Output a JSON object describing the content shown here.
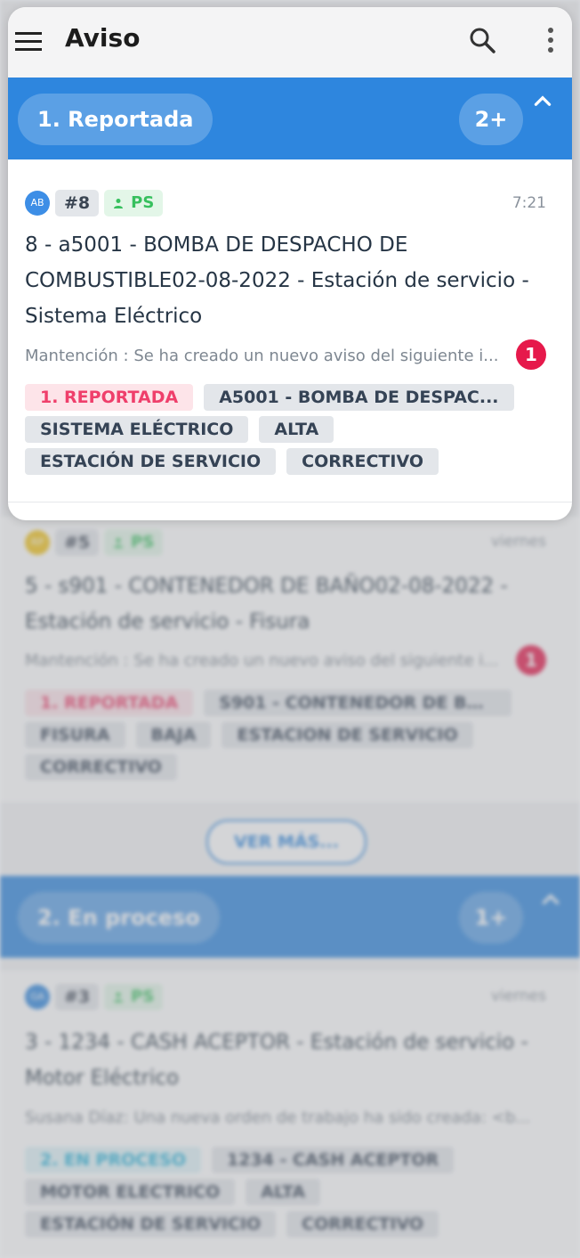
{
  "app_title": "Aviso",
  "sections": [
    {
      "label": "1. Reportada",
      "count": "2+",
      "cards": [
        {
          "avatar": "AB",
          "number": "#8",
          "assignee": "PS",
          "time": "7:21",
          "title": "8 - a5001 - BOMBA DE DESPACHO DE COMBUSTIBLE02-08-2022 - Estación de servicio - Sistema Eléctrico",
          "description": "Mantención : Se ha creado un nuevo aviso del siguiente i...",
          "unread": "1",
          "tags": [
            "1. REPORTADA",
            "A5001 - BOMBA DE DESPAC...",
            "SISTEMA ELÉCTRICO",
            "ALTA",
            "ESTACIÓN DE SERVICIO",
            "CORRECTIVO"
          ]
        },
        {
          "avatar": "RP",
          "number": "#5",
          "assignee": "PS",
          "time": "viernes",
          "title": "5 - s901 - CONTENEDOR DE BAÑO02-08-2022 - Estación de servicio - Fisura",
          "description": "Mantención : Se ha creado un nuevo aviso del siguiente i...",
          "unread": "1",
          "tags": [
            "1. REPORTADA",
            "S901 - CONTENEDOR DE BA...",
            "FISURA",
            "BAJA",
            "ESTACION DE SERVICIO",
            "CORRECTIVO"
          ]
        }
      ],
      "more_label": "VER MÁS..."
    },
    {
      "label": "2. En proceso",
      "count": "1+",
      "cards": [
        {
          "avatar": "GA",
          "number": "#3",
          "assignee": "PS",
          "time": "viernes",
          "title": "3 - 1234 - CASH ACEPTOR - Estación de servicio - Motor Eléctrico",
          "description": "Susana Díaz: Una nueva orden de trabajo ha sido creada: <b...",
          "tags": [
            "2. EN PROCESO",
            "1234 - CASH ACEPTOR",
            "MOTOR ELECTRICO",
            "ALTA",
            "ESTACIÓN DE SERVICIO",
            "CORRECTIVO"
          ]
        }
      ]
    }
  ],
  "colors": {
    "section_bar": "#2e86de",
    "badge": "#e6194b",
    "status_reportada": "#ef3f6b",
    "status_en_proceso": "#29b3d9",
    "assignee": "#37c05e"
  },
  "icons": {
    "menu": "menu-icon",
    "search": "search-icon",
    "more": "more-vert-icon",
    "collapse": "chevron-up-icon",
    "person": "person-icon"
  }
}
